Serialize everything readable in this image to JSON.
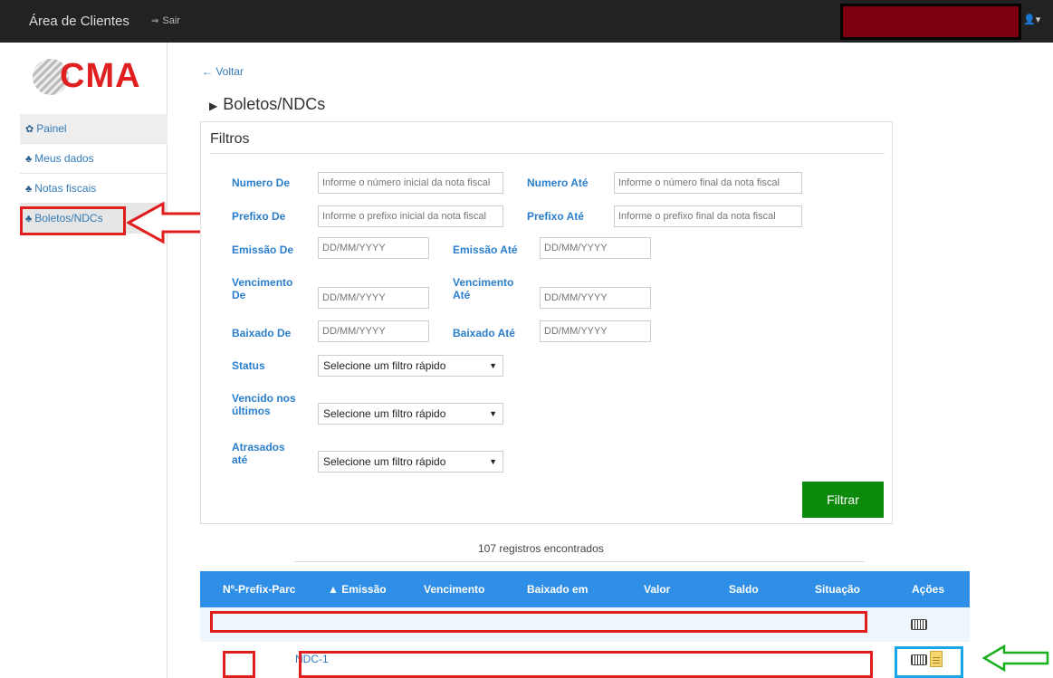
{
  "navbar": {
    "brand": "Área de Clientes",
    "logout_label": "Sair",
    "logout_icon": "logout-icon",
    "user_icon": "user-icon",
    "user_caret": "▾"
  },
  "sidebar": {
    "logo_text": "CMA",
    "items": [
      {
        "label": "Painel",
        "icon": "dashboard-icon"
      },
      {
        "label": "Meus dados",
        "icon": "sitemap-icon"
      },
      {
        "label": "Notas fiscais",
        "icon": "sitemap-icon"
      },
      {
        "label": "Boletos/NDCs",
        "icon": "sitemap-icon"
      }
    ]
  },
  "main": {
    "back_label": "Voltar",
    "page_title": "Boletos/NDCs",
    "filters": {
      "title": "Filtros",
      "numero_de_label": "Numero De",
      "numero_de_placeholder": "Informe o número inicial da nota fiscal",
      "numero_ate_label": "Numero Até",
      "numero_ate_placeholder": "Informe o número final da nota fiscal",
      "prefixo_de_label": "Prefixo De",
      "prefixo_de_placeholder": "Informe o prefixo inicial da nota fiscal",
      "prefixo_ate_label": "Prefixo Até",
      "prefixo_ate_placeholder": "Informe o prefixo final da nota fiscal",
      "emissao_de_label": "Emissão De",
      "emissao_ate_label": "Emissão Até",
      "vencimento_de_label_1": "Vencimento",
      "vencimento_de_label_2": "De",
      "vencimento_ate_label_1": "Vencimento",
      "vencimento_ate_label_2": "Até",
      "baixado_de_label": "Baixado De",
      "baixado_ate_label": "Baixado Até",
      "date_placeholder": "DD/MM/YYYY",
      "status_label": "Status",
      "vencido_label_1": "Vencido nos",
      "vencido_label_2": "últimos",
      "atrasados_label_1": "Atrasados",
      "atrasados_label_2": "até",
      "select_placeholder": "Selecione um filtro rápido",
      "submit_label": "Filtrar"
    },
    "records_text": "107 registros encontrados",
    "table": {
      "headers": [
        "Nº-Prefix-Parc",
        "▲ Emissão",
        "Vencimento",
        "Baixado em",
        "Valor",
        "Saldo",
        "Situação",
        "Ações"
      ],
      "rows": [
        {
          "id": ""
        },
        {
          "id": "NDC-1"
        }
      ]
    }
  }
}
